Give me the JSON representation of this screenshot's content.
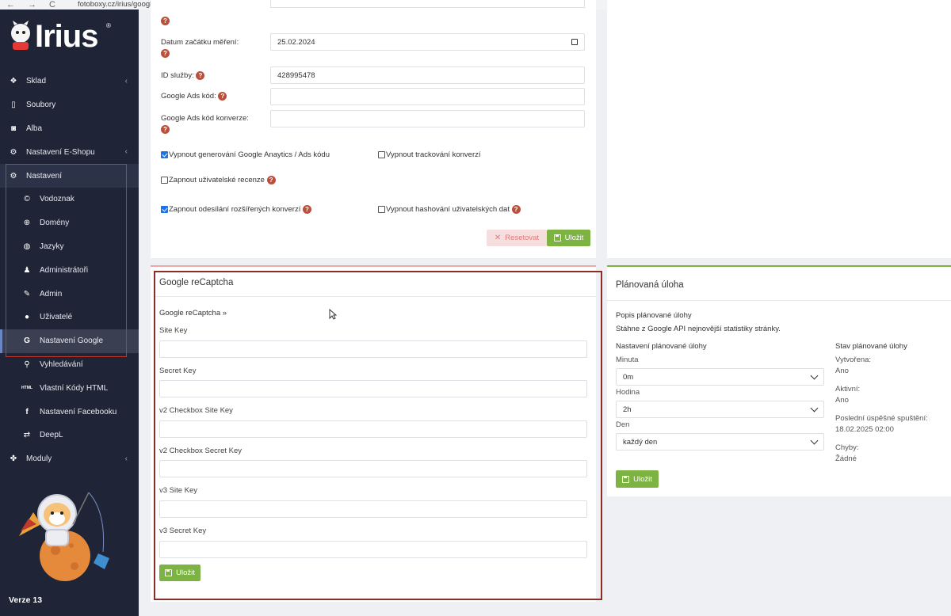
{
  "browser": {
    "nav_back": "←",
    "nav_forward": "→",
    "nav_reload": "C",
    "url": "fotoboxy.cz/irius/google-settings/",
    "star": "☆"
  },
  "sidebar": {
    "logo_text": "Irius",
    "logo_mark": "®",
    "version": "Verze 13",
    "items": [
      {
        "label": "Sklad",
        "icon": "dropbox-icon",
        "chevron": "‹"
      },
      {
        "label": "Soubory",
        "icon": "file-icon"
      },
      {
        "label": "Alba",
        "icon": "camera-icon"
      },
      {
        "label": "Nastavení E-Shopu",
        "icon": "cogs-icon",
        "chevron": "‹"
      },
      {
        "label": "Nastavení",
        "icon": "cogs-icon"
      },
      {
        "label": "Vodoznak",
        "icon": "copyright-icon"
      },
      {
        "label": "Domény",
        "icon": "globe-icon"
      },
      {
        "label": "Jazyky",
        "icon": "earth-icon"
      },
      {
        "label": "Administrátoři",
        "icon": "user-tie-icon"
      },
      {
        "label": "Admin",
        "icon": "wrench-icon"
      },
      {
        "label": "Uživatelé",
        "icon": "user-icon"
      },
      {
        "label": "Nastavení Google",
        "icon": "google-icon"
      },
      {
        "label": "Vyhledávání",
        "icon": "search-icon"
      },
      {
        "label": "Vlastní Kódy HTML",
        "icon": "html-icon"
      },
      {
        "label": "Nastavení Facebooku",
        "icon": "facebook-icon"
      },
      {
        "label": "DeepL",
        "icon": "translate-icon"
      },
      {
        "label": "Moduly",
        "icon": "puzzle-icon",
        "chevron": "‹"
      }
    ]
  },
  "top_form": {
    "help_glyph": "?",
    "datum_label": "Datum začátku měření:",
    "datum_value": "25.02.2024",
    "id_label": "ID služby:",
    "id_value": "428995478",
    "ads_label": "Google Ads kód:",
    "ads_conv_label": "Google Ads kód konverze:",
    "cb1": "Vypnout generování Google Anaytics / Ads kódu",
    "cb2": "Vypnout trackování konverzí",
    "cb3": "Zapnout uživatelské recenze",
    "cb4": "Zapnout odesílání rozšířených konverzí",
    "cb5": "Vypnout hashování uživatelských dat",
    "reset_icon": "✕",
    "reset_label": "Resetovat",
    "save_label": "Uložit"
  },
  "recaptcha": {
    "title": "Google reCaptcha",
    "subtitle": "Google reCaptcha »",
    "fields": [
      {
        "label": "Site Key"
      },
      {
        "label": "Secret Key"
      },
      {
        "label": "v2 Checkbox Site Key"
      },
      {
        "label": "v2 Checkbox Secret Key"
      },
      {
        "label": "v3 Site Key"
      },
      {
        "label": "v3 Secret Key"
      }
    ],
    "save_label": "Uložit"
  },
  "task": {
    "title": "Plánovaná úloha",
    "desc_heading": "Popis plánované úlohy",
    "desc_text": "Stáhne z Google API nejnovější statistiky stránky.",
    "settings_heading": "Nastavení plánované úlohy",
    "minute_label": "Minuta",
    "minute_value": "0m",
    "hour_label": "Hodina",
    "hour_value": "2h",
    "day_label": "Den",
    "day_value": "každý den",
    "save_label": "Uložit",
    "status_heading": "Stav plánované úlohy",
    "created_label": "Vytvořena:",
    "created_value": "Ano",
    "active_label": "Aktivní:",
    "active_value": "Ano",
    "last_run_label": "Poslední úspěšné spuštění:",
    "last_run_value": "18.02.2025 02:00",
    "errors_label": "Chyby:",
    "errors_value": "Žádné"
  }
}
